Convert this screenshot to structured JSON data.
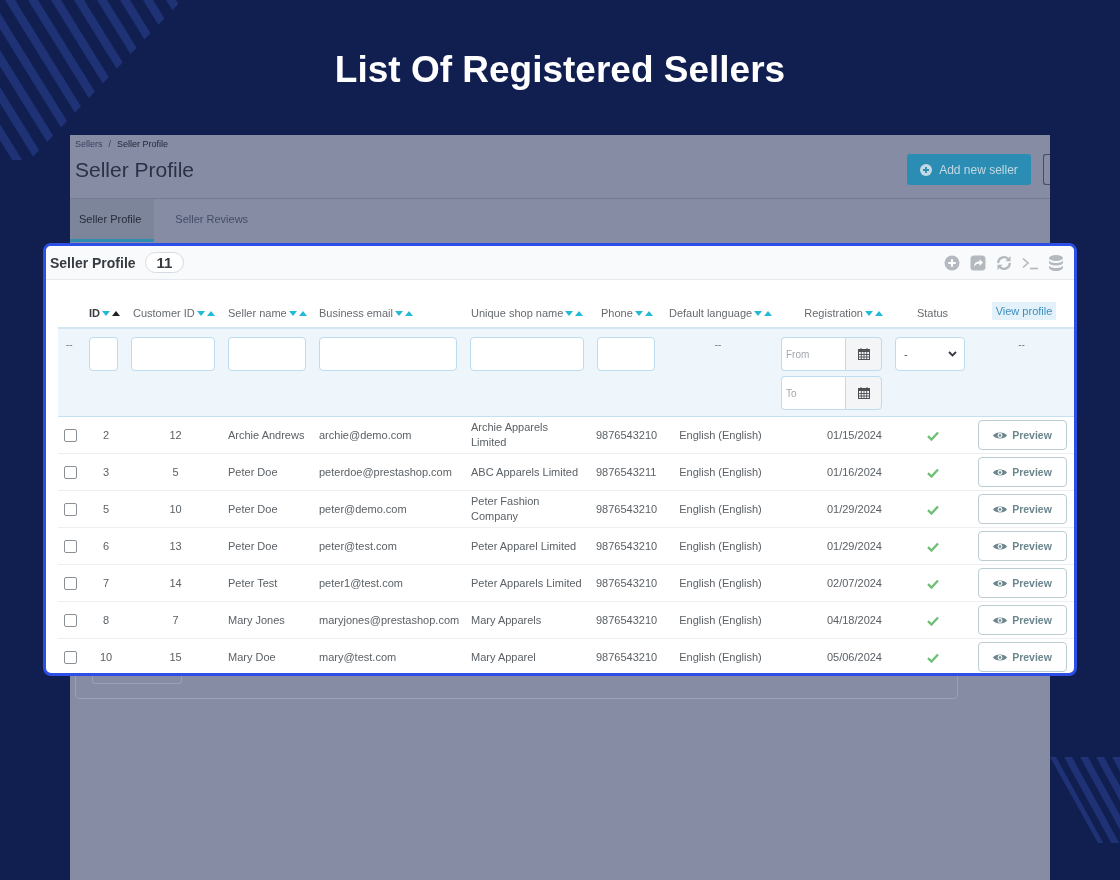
{
  "heading": "List Of Registered Sellers",
  "background_page": {
    "breadcrumb": [
      {
        "label": "Sellers",
        "current": false
      },
      {
        "label": "Seller Profile",
        "current": true
      }
    ],
    "breadcrumb_separator": "/",
    "title": "Seller Profile",
    "add_button": "Add new seller",
    "tabs": [
      {
        "label": "Seller Profile",
        "selected": true
      },
      {
        "label": "Seller Reviews",
        "selected": false
      }
    ]
  },
  "panel": {
    "title": "Seller Profile",
    "count": "11",
    "columns": [
      {
        "label": "ID",
        "kind": "sortable",
        "sorted_ascending": true,
        "highlighted": false
      },
      {
        "label": "Customer ID",
        "kind": "sortable",
        "sorted_ascending": false,
        "highlighted": false
      },
      {
        "label": "Seller name",
        "kind": "sortable",
        "sorted_ascending": false,
        "highlighted": false
      },
      {
        "label": "Business email",
        "kind": "sortable",
        "sorted_ascending": false,
        "highlighted": false
      },
      {
        "label": "Unique shop name",
        "kind": "sortable",
        "sorted_ascending": false,
        "highlighted": false
      },
      {
        "label": "Phone",
        "kind": "sortable",
        "sorted_ascending": false,
        "highlighted": false
      },
      {
        "label": "Default language",
        "kind": "sortable",
        "sorted_ascending": false,
        "highlighted": false
      },
      {
        "label": "Registration",
        "kind": "sortable",
        "sorted_ascending": false,
        "highlighted": false
      },
      {
        "label": "Status",
        "kind": "plain",
        "highlighted": false
      },
      {
        "label": "View profile",
        "kind": "plain",
        "highlighted": true
      }
    ],
    "filters": [
      {
        "kind": "dash",
        "text": "--"
      },
      {
        "kind": "text"
      },
      {
        "kind": "text"
      },
      {
        "kind": "text"
      },
      {
        "kind": "text"
      },
      {
        "kind": "text"
      },
      {
        "kind": "text"
      },
      {
        "kind": "dash",
        "text": "--"
      },
      {
        "kind": "date_range",
        "from_placeholder": "From",
        "to_placeholder": "To"
      },
      {
        "kind": "select",
        "value": "-"
      },
      {
        "kind": "dash",
        "text": "--"
      }
    ],
    "rows": [
      {
        "checked": false,
        "id": "2",
        "customer_id": "12",
        "seller_name": "Archie Andrews",
        "email": "archie@demo.com",
        "shop_name": "Archie Apparels Limited",
        "phone": "9876543210",
        "language": "English (English)",
        "registration": "01/15/2024",
        "active": true,
        "action": "Preview"
      },
      {
        "checked": false,
        "id": "3",
        "customer_id": "5",
        "seller_name": "Peter Doe",
        "email": "peterdoe@prestashop.com",
        "shop_name": "ABC Apparels Limited",
        "phone": "9876543211",
        "language": "English (English)",
        "registration": "01/16/2024",
        "active": true,
        "action": "Preview"
      },
      {
        "checked": false,
        "id": "5",
        "customer_id": "10",
        "seller_name": "Peter Doe",
        "email": "peter@demo.com",
        "shop_name": "Peter Fashion Company",
        "phone": "9876543210",
        "language": "English (English)",
        "registration": "01/29/2024",
        "active": true,
        "action": "Preview"
      },
      {
        "checked": false,
        "id": "6",
        "customer_id": "13",
        "seller_name": "Peter Doe",
        "email": "peter@test.com",
        "shop_name": "Peter Apparel Limited",
        "phone": "9876543210",
        "language": "English (English)",
        "registration": "01/29/2024",
        "active": true,
        "action": "Preview"
      },
      {
        "checked": false,
        "id": "7",
        "customer_id": "14",
        "seller_name": "Peter Test",
        "email": "peter1@test.com",
        "shop_name": "Peter Apparels Limited",
        "phone": "9876543210",
        "language": "English (English)",
        "registration": "02/07/2024",
        "active": true,
        "action": "Preview"
      },
      {
        "checked": false,
        "id": "8",
        "customer_id": "7",
        "seller_name": "Mary Jones",
        "email": "maryjones@prestashop.com",
        "shop_name": "Mary Apparels",
        "phone": "9876543210",
        "language": "English (English)",
        "registration": "04/18/2024",
        "active": true,
        "action": "Preview"
      },
      {
        "checked": false,
        "id": "10",
        "customer_id": "15",
        "seller_name": "Mary Doe",
        "email": "mary@test.com",
        "shop_name": "Mary Apparel",
        "phone": "9876543210",
        "language": "English (English)",
        "registration": "05/06/2024",
        "active": true,
        "action": "Preview"
      }
    ]
  }
}
